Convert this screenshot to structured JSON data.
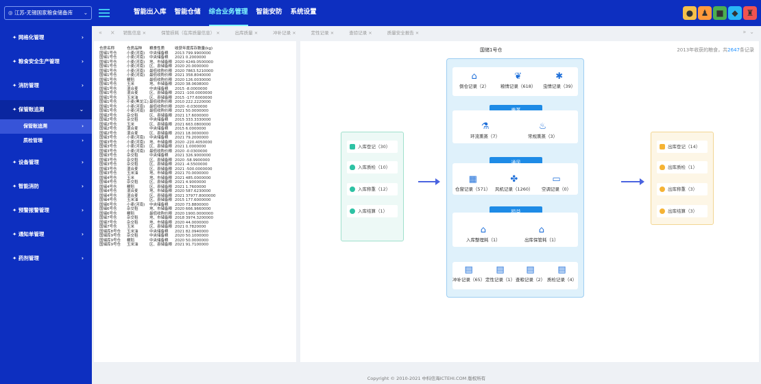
{
  "header": {
    "depot_select": "江苏-无锡国家粮食储备库",
    "nav": [
      "智能出入库",
      "智能仓储",
      "综合业务管理",
      "智能安防",
      "系统设置"
    ],
    "active_nav": 2,
    "icons": [
      "bell-icon",
      "user-icon",
      "car-icon",
      "chat-icon",
      "user-group-icon"
    ]
  },
  "sidebar": {
    "items": [
      {
        "label": "网格化管理"
      },
      {
        "label": "粮食安全生产管理"
      },
      {
        "label": "消防管理"
      },
      {
        "label": "保管账追溯",
        "open": true
      },
      {
        "label": "设备管理"
      },
      {
        "label": "智能消防"
      },
      {
        "label": "预警报警管理"
      },
      {
        "label": "通知单管理"
      },
      {
        "label": "药剂管理"
      }
    ],
    "subitems": [
      "保管账追溯",
      "质检管理"
    ]
  },
  "tabs": [
    "销售信息",
    "保管损耗（在库质量信息）",
    "出库质量",
    "冲补记录",
    "定性记录",
    "查验记录",
    "质量安全报告"
  ],
  "table": {
    "headers": [
      "仓房名称",
      "仓房品种",
      "粮食性质",
      "收获年度库存数量(kg)"
    ],
    "rows": [
      [
        "国储1号仓",
        "小麦(河南)",
        "中央储备粮",
        "2013",
        "799.9900000"
      ],
      [
        "国储1号仓",
        "小麦(河南)",
        "中央储备粮",
        "2021",
        "0.2000000"
      ],
      [
        "国储1号仓",
        "小麦(河南)",
        "地、市储备粮",
        "2020",
        "4249.0500000"
      ],
      [
        "国储1号仓",
        "小麦(河南)",
        "区、县储备粮",
        "2020",
        "20.0000000"
      ],
      [
        "国储1号仓",
        "小麦(河南)",
        "最低收购价粮",
        "2020",
        "7863.5210000"
      ],
      [
        "国储1号仓",
        "小麦(河南)",
        "最低收购价粮",
        "2021",
        "358.8040000"
      ],
      [
        "国储1号仓",
        "粳稻",
        "最低收购价粮",
        "2020",
        "126.0030000"
      ],
      [
        "国储1号仓",
        "玉米",
        "地、市储备粮",
        "2020",
        "38.0608000"
      ],
      [
        "国储1号仓",
        "混合麦",
        "中央储备粮",
        "2015",
        "-8.0000000"
      ],
      [
        "国储1号仓",
        "混合麦",
        "区、县储备粮",
        "2021",
        "-100.0000000"
      ],
      [
        "国储1号仓",
        "玉米油",
        "区、县储备粮",
        "2015",
        "-177.6000000"
      ],
      [
        "国储1号仓",
        "小麦(黑龙江)",
        "最低收购价粮",
        "2010",
        "222.2220000"
      ],
      [
        "国储1号仓",
        "小麦(河南)",
        "最低收购价粮",
        "2020",
        "-0.0300000"
      ],
      [
        "国储1号仓",
        "小麦(河南)",
        "最低收购价粮",
        "2021",
        "50.0000000"
      ],
      [
        "国储2号仓",
        "杂交稻",
        "区、县储备粮",
        "2021",
        "17.6000000"
      ],
      [
        "国储2号仓",
        "杂交稻",
        "中央储备粮",
        "2015",
        "333.3330000"
      ],
      [
        "国储2号仓",
        "玉米",
        "区、县储备粮",
        "2021",
        "663.0800000"
      ],
      [
        "国储2号仓",
        "混合麦",
        "中央储备粮",
        "2015",
        "6.0000000"
      ],
      [
        "国储2号仓",
        "混合麦",
        "区、县储备粮",
        "2021",
        "18.0000000"
      ],
      [
        "国储3号仓",
        "小麦(河南)",
        "中央储备粮",
        "2021",
        "79.2000000"
      ],
      [
        "国储3号仓",
        "小麦(河南)",
        "地、市储备粮",
        "2020",
        "-220.4050000"
      ],
      [
        "国储3号仓",
        "小麦(河南)",
        "区、县储备粮",
        "2021",
        "1.0000000"
      ],
      [
        "国储3号仓",
        "小麦(河南)",
        "最低收购价粮",
        "2020",
        "-0.0300000"
      ],
      [
        "国储3号仓",
        "杂交稻",
        "中央储备粮",
        "2021",
        "326.9000000"
      ],
      [
        "国储3号仓",
        "杂交稻",
        "区、县储备粮",
        "2020",
        "-58.9900000"
      ],
      [
        "国储3号仓",
        "杂交稻",
        "区、县储备粮",
        "2021",
        "-4.5500000"
      ],
      [
        "国储3号仓",
        "混合麦",
        "区、县储备粮",
        "2021",
        "-500.0000000"
      ],
      [
        "国储3号仓",
        "玉米油",
        "地、市储备粮",
        "2021",
        "70.0000000"
      ],
      [
        "国储4号仓",
        "玉米",
        "地、市储备粮",
        "2021",
        "485.0000000"
      ],
      [
        "国储4号仓",
        "杂交稻",
        "区、县储备粮",
        "2021",
        "4.9000000"
      ],
      [
        "国储4号仓",
        "粳稻",
        "区、县储备粮",
        "2021",
        "1.7600000"
      ],
      [
        "国储4号仓",
        "混合麦",
        "地、市储备粮",
        "2020",
        "587.6230000"
      ],
      [
        "国储4号仓",
        "混合麦",
        "区、县储备粮",
        "2021",
        "37977.8000000"
      ],
      [
        "国储4号仓",
        "玉米油",
        "区、县储备粮",
        "2015",
        "177.6000000"
      ],
      [
        "国储6号仓",
        "小麦(河南)",
        "中央储备粮",
        "2020",
        "73.8800000"
      ],
      [
        "国储6号仓",
        "杂交稻",
        "地、市储备粮",
        "2020",
        "666.9660000"
      ],
      [
        "国储6号仓",
        "粳稻",
        "最低收购价粮",
        "2020",
        "1900.0000000"
      ],
      [
        "国储7号仓",
        "杂交稻",
        "地、市储备粮",
        "2018",
        "3974.3200000"
      ],
      [
        "国储7号仓",
        "杂交稻",
        "地、市储备粮",
        "2020",
        "44.0000000"
      ],
      [
        "国储7号仓",
        "玉米",
        "区、县储备粮",
        "2021",
        "0.7820000"
      ],
      [
        "国储库8号仓",
        "玉米油",
        "中央储备粮",
        "2021",
        "82.0940000"
      ],
      [
        "国储库9号仓",
        "杂交稻",
        "中央储备粮",
        "2020",
        "50.1000000"
      ],
      [
        "国储库9号仓",
        "粳稻",
        "中央储备粮",
        "2020",
        "50.0000000"
      ],
      [
        "国储库9号仓",
        "玉米油",
        "区、县储备粮",
        "2021",
        "91.7100000"
      ]
    ]
  },
  "right": {
    "silo_title": "国储1号仓",
    "summary_prefix": "2013年收获的粮食，共",
    "summary_count": "2647",
    "summary_suffix": "条记录",
    "in_buttons": [
      "入库登记（30）",
      "入库质检（10）",
      "入库称重（12）",
      "入库结算（1）"
    ],
    "out_buttons": [
      "出库登记（14）",
      "出库质检（1）",
      "出库称重（3）",
      "出库结算（3）"
    ],
    "top_items": [
      "倒仓记录（2）",
      "粮情记录（618）",
      "虫情记录（39）"
    ],
    "fumigation": {
      "title": "熏蒸",
      "items": [
        "环流熏蒸（7）",
        "常规熏蒸（3）"
      ]
    },
    "ventilation": {
      "title": "通风",
      "items": [
        "仓窗记录（571）",
        "风机记录（1260）",
        "空调记录（0）"
      ]
    },
    "loss": {
      "title": "损益",
      "items": [
        "入库整理耗（1）",
        "出库保管耗（1）"
      ]
    },
    "bottom_items": [
      "冲补记录（65）",
      "定性记录（1）",
      "查粮记录（2）",
      "质检记录（4）"
    ]
  },
  "footer": "Copyright © 2010-2021 中科信海ICTEHI.COM 版权所有"
}
